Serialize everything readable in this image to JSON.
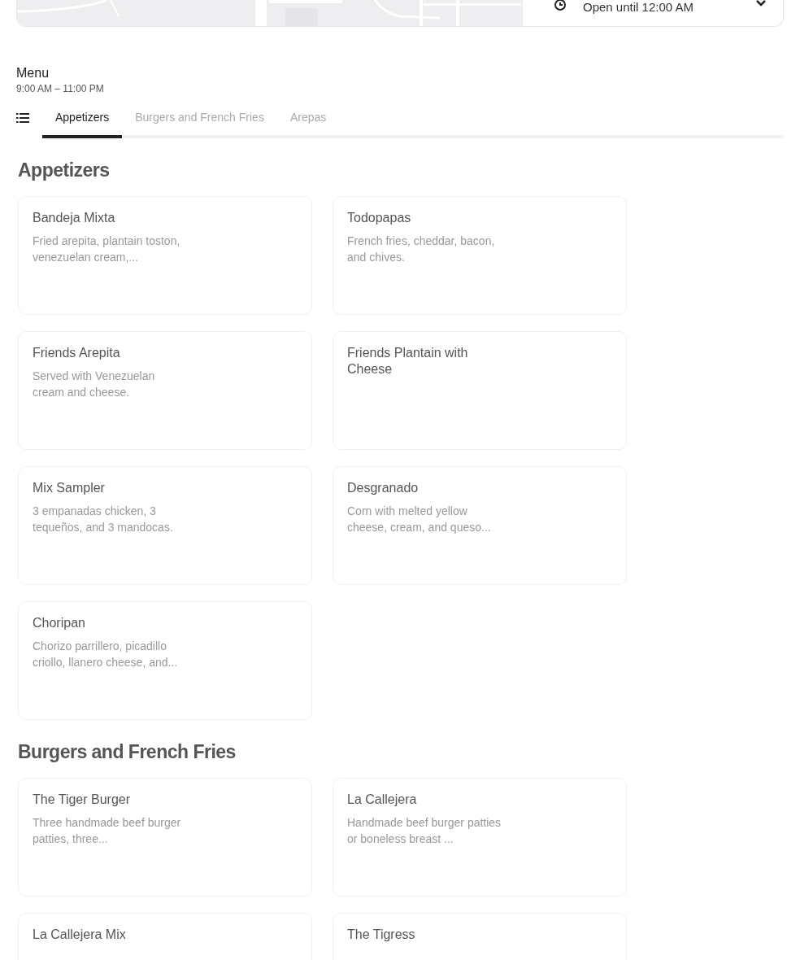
{
  "store_bar": {
    "hours_status": "Open until 12:00 AM"
  },
  "menu": {
    "title": "Menu",
    "hours": "9:00 AM – 11:00 PM"
  },
  "tabs": [
    {
      "label": "Appetizers",
      "selected": true
    },
    {
      "label": "Burgers and French Fries",
      "selected": false
    },
    {
      "label": "Arepas",
      "selected": false
    }
  ],
  "sections": [
    {
      "title": "Appetizers",
      "items": [
        {
          "name": "Bandeja Mixta",
          "description": "Fried arepita, plantain toston, venezuelan cream,..."
        },
        {
          "name": "Todopapas",
          "description": "French fries, cheddar, bacon, and chives."
        },
        {
          "name": "Friends Arepita",
          "description": "Served with Venezuelan cream and cheese."
        },
        {
          "name": "Friends Plantain with Cheese"
        },
        {
          "name": "Mix Sampler",
          "description": "3 empanadas chicken, 3 tequeños, and 3 mandocas."
        },
        {
          "name": "Desgranado",
          "description": "Corn with melted yellow cheese, cream, and queso..."
        },
        {
          "name": "Choripan",
          "description": "Chorizo parrillero, picadillo criollo, llanero cheese, and..."
        }
      ]
    },
    {
      "title": "Burgers and French Fries",
      "items": [
        {
          "name": "The Tiger Burger",
          "description": "Three handmade beef burger patties, three..."
        },
        {
          "name": "La Callejera",
          "description": "Handmade beef burger patties or boneless breast ..."
        },
        {
          "name": "La Callejera Mix"
        },
        {
          "name": "The Tigress"
        }
      ]
    }
  ]
}
